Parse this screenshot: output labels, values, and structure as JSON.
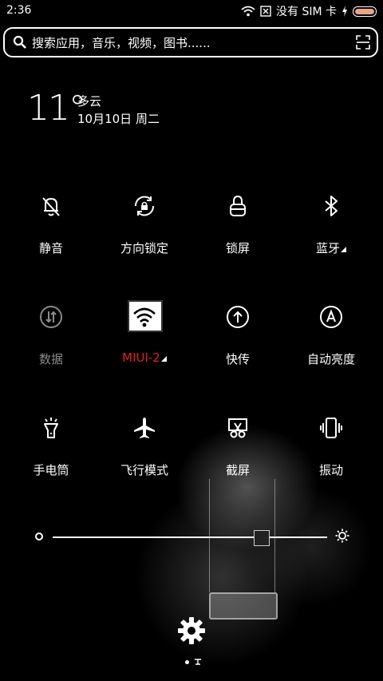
{
  "status": {
    "time": "2:36",
    "sim_text": "没有 SIM 卡"
  },
  "search": {
    "placeholder": "搜索应用，音乐，视频，图书......"
  },
  "weather": {
    "temperature": "11°",
    "condition": "多云",
    "date": "10月10日 周二"
  },
  "toggles": [
    {
      "label": "静音",
      "icon": "bell-off-icon",
      "active": false
    },
    {
      "label": "方向锁定",
      "icon": "rotation-lock-icon",
      "active": false
    },
    {
      "label": "锁屏",
      "icon": "lock-icon",
      "active": false
    },
    {
      "label": "蓝牙",
      "icon": "bluetooth-icon",
      "active": false
    },
    {
      "label": "数据",
      "icon": "mobile-data-icon",
      "active": false,
      "disabled": true
    },
    {
      "label": "MIUI-2",
      "icon": "wifi-icon",
      "active": true
    },
    {
      "label": "快传",
      "icon": "quick-transfer-icon",
      "active": false
    },
    {
      "label": "自动亮度",
      "icon": "auto-brightness-icon",
      "active": false
    },
    {
      "label": "手电筒",
      "icon": "flashlight-icon",
      "active": false
    },
    {
      "label": "飞行模式",
      "icon": "airplane-icon",
      "active": false
    },
    {
      "label": "截屏",
      "icon": "screenshot-icon",
      "active": false
    },
    {
      "label": "振动",
      "icon": "vibrate-icon",
      "active": false
    }
  ],
  "brightness": {
    "level": 0.76
  },
  "colors": {
    "active_label": "#e02020",
    "disabled": "#8a8a8a",
    "foreground": "#ffffff",
    "background": "#000000"
  }
}
